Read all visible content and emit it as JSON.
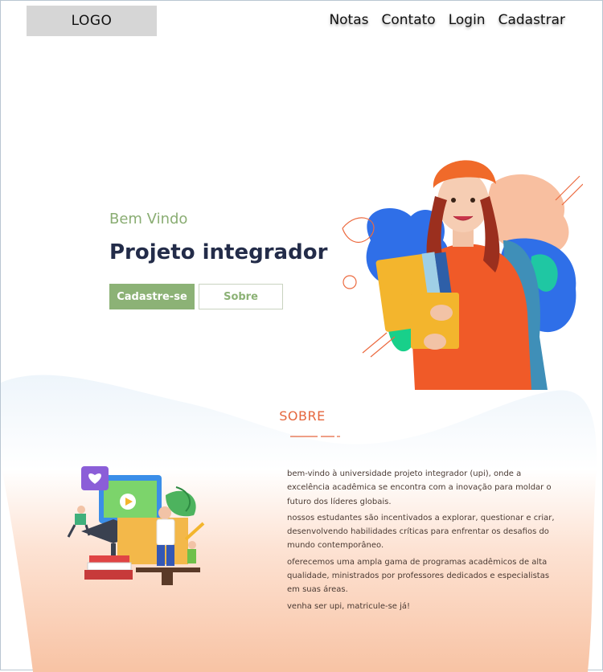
{
  "header": {
    "logo": "LOGO",
    "nav": [
      "Notas",
      "Contato",
      "Login",
      "Cadastrar"
    ]
  },
  "hero": {
    "welcome": "Bem Vindo",
    "title": "Projeto integrador",
    "primary_button": "Cadastre-se",
    "secondary_button": "Sobre"
  },
  "about": {
    "title": "SOBRE",
    "paragraphs": [
      "bem-vindo à universidade projeto integrador (upi), onde a excelência acadêmica se encontra com a inovação para moldar o futuro dos líderes globais.",
      "nossos estudantes são incentivados a explorar, questionar e criar, desenvolvendo habilidades críticas para enfrentar os desafios do mundo contemporâneo.",
      "oferecemos uma ampla gama de programas acadêmicos de alta qualidade, ministrados por professores dedicados e especialistas em suas áreas.",
      "venha ser upi, matricule-se já!"
    ]
  },
  "colors": {
    "accent_green": "#8cb276",
    "title_navy": "#232c49",
    "about_orange": "#e5663d",
    "wave_peach": "#f8c3a4"
  }
}
